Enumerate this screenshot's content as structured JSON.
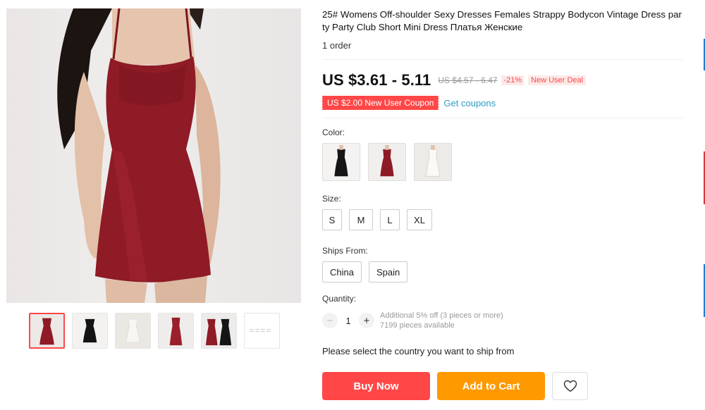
{
  "product": {
    "title": "25# Womens Off-shoulder Sexy Dresses Females Strappy Bodycon Vintage Dress party Party Club Short Mini Dress Платья Женские",
    "orders": "1 order"
  },
  "gallery": {
    "main_image": "red-bodycon-dress-photo",
    "thumbnails": [
      "red-dress-thumb",
      "black-dress-thumb",
      "white-dress-thumb",
      "red-dress-back-thumb",
      "red-black-dress-thumb",
      "size-chart-thumb"
    ]
  },
  "pricing": {
    "price": "US $3.61 - 5.11",
    "original_price": "US $4.57 - 6.47",
    "discount": "-21%",
    "deal_badge": "New User Deal",
    "coupon": "US $2.00 New User Coupon",
    "get_coupons": "Get coupons"
  },
  "options": {
    "color_label": "Color:",
    "colors": [
      "black",
      "red",
      "white"
    ],
    "size_label": "Size:",
    "sizes": [
      "S",
      "M",
      "L",
      "XL"
    ],
    "ships_from_label": "Ships From:",
    "ships_from": [
      "China",
      "Spain"
    ]
  },
  "quantity": {
    "label": "Quantity:",
    "value": "1",
    "minus": "−",
    "plus": "+",
    "discount_note": "Additional 5% off (3 pieces or more)",
    "available": "7199 pieces available"
  },
  "shipping_message": "Please select the country you want to ship from",
  "actions": {
    "buy_now": "Buy Now",
    "add_to_cart": "Add to Cart"
  },
  "colors": {
    "accent_red": "#ff4747",
    "cart_orange": "#ff9900",
    "link_blue": "#2e9cc3",
    "dress_red": "#8e1b26"
  }
}
